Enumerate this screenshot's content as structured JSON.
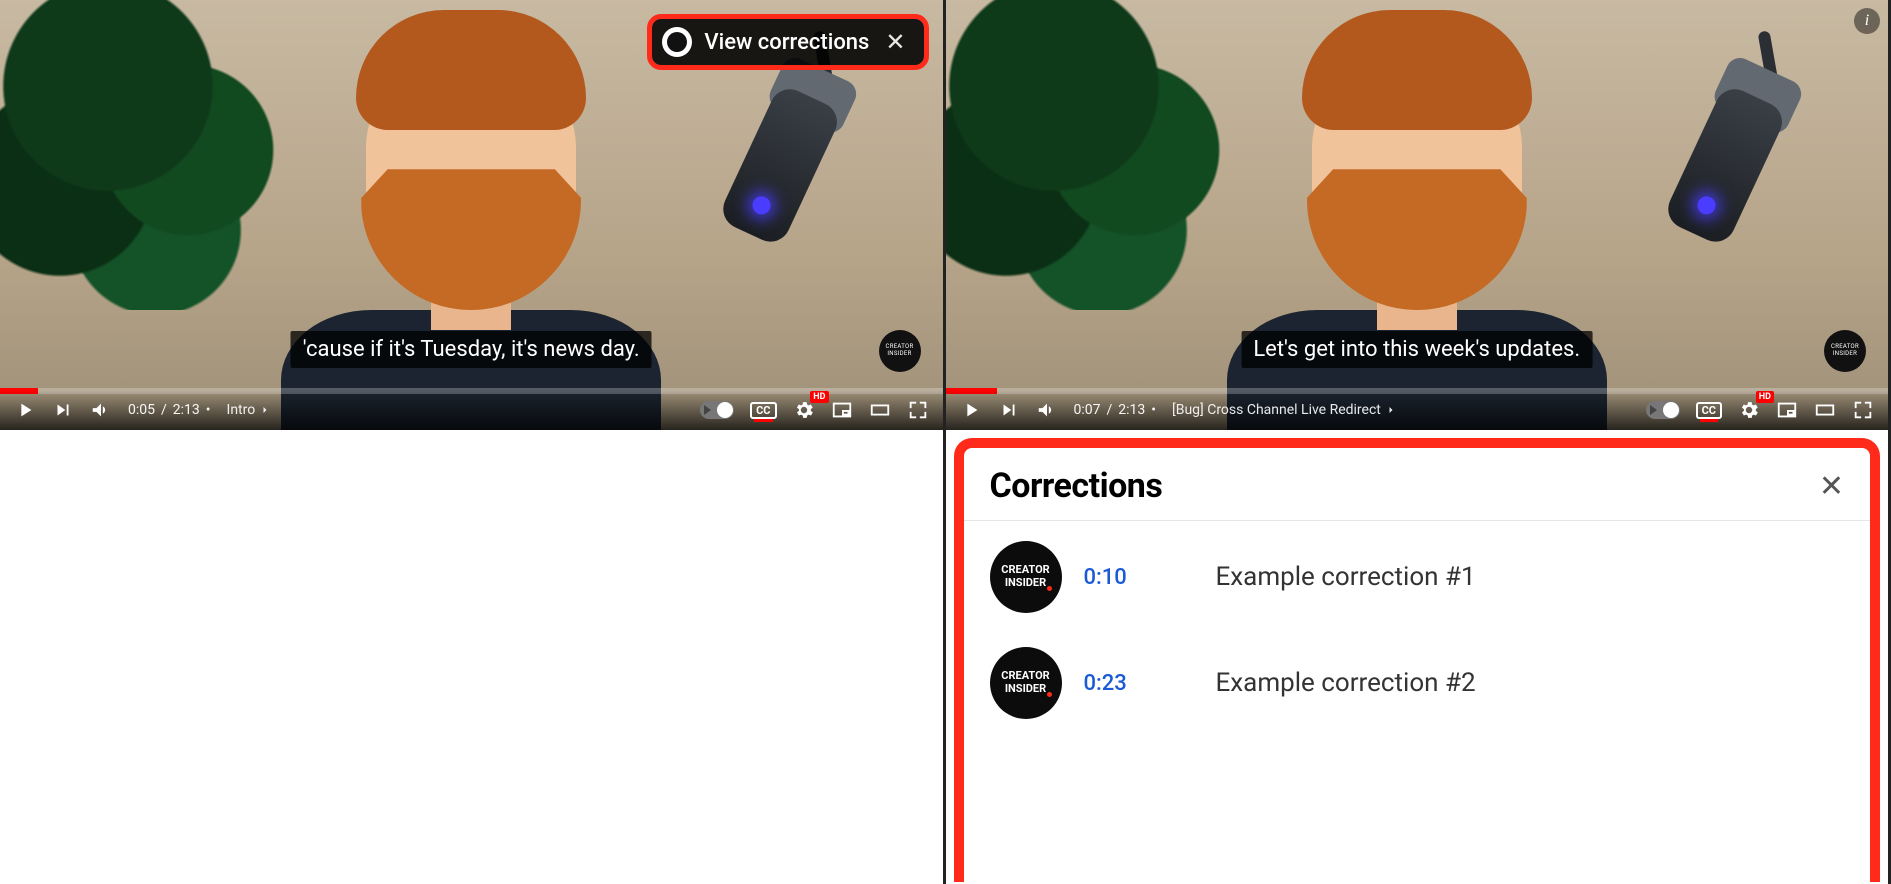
{
  "left": {
    "caption": "'cause if it's Tuesday, it's news day.",
    "view_corrections": {
      "label": "View corrections"
    },
    "controls": {
      "time_current": "0:05",
      "time_total": "2:13",
      "chapter": "Intro",
      "cc_label": "CC",
      "hd_label": "HD"
    },
    "small_badge": "CREATOR INSIDER"
  },
  "right": {
    "caption": "Let's get into this week's updates.",
    "controls": {
      "time_current": "0:07",
      "time_total": "2:13",
      "chapter": "[Bug] Cross Channel Live Redirect",
      "cc_label": "CC",
      "hd_label": "HD"
    },
    "small_badge": "CREATOR INSIDER",
    "corrections": {
      "title": "Corrections",
      "avatar_label": "CREATOR INSIDER",
      "items": [
        {
          "ts": "0:10",
          "text": "Example correction #1"
        },
        {
          "ts": "0:23",
          "text": "Example correction #2"
        }
      ]
    }
  }
}
